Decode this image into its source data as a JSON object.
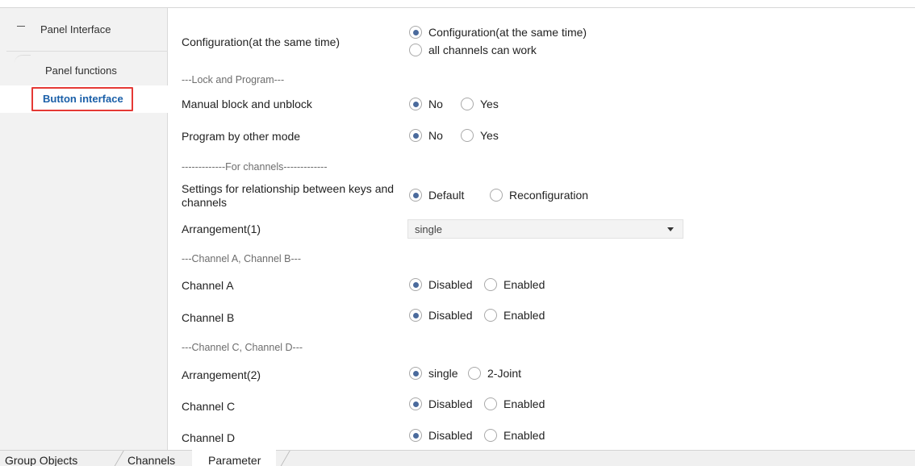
{
  "sidebar": {
    "root_label": "Panel Interface",
    "items": [
      {
        "label": "Panel functions"
      },
      {
        "label": "Button interface"
      }
    ]
  },
  "params": {
    "config": {
      "label": "Configuration(at the same time)",
      "options": [
        "Configuration(at the same time)",
        "all channels can work"
      ],
      "selected": 0
    },
    "heading_lock": "---Lock and Program---",
    "manual_block": {
      "label": "Manual block and unblock",
      "options": [
        "No",
        "Yes"
      ],
      "selected": 0
    },
    "program_other": {
      "label": "Program by other mode",
      "options": [
        "No",
        "Yes"
      ],
      "selected": 0
    },
    "heading_channels": "-------------For channels-------------",
    "relationship": {
      "label": "Settings for relationship between keys and channels",
      "options": [
        "Default",
        "Reconfiguration"
      ],
      "selected": 0
    },
    "arrangement1": {
      "label": "Arrangement(1)",
      "value": "single"
    },
    "heading_ab": "---Channel A, Channel B---",
    "channel_a": {
      "label": "Channel A",
      "options": [
        "Disabled",
        "Enabled"
      ],
      "selected": 0
    },
    "channel_b": {
      "label": "Channel B",
      "options": [
        "Disabled",
        "Enabled"
      ],
      "selected": 0
    },
    "heading_cd": "---Channel C, Channel D---",
    "arrangement2": {
      "label": "Arrangement(2)",
      "options": [
        "single",
        "2-Joint"
      ],
      "selected": 0
    },
    "channel_c": {
      "label": "Channel C",
      "options": [
        "Disabled",
        "Enabled"
      ],
      "selected": 0
    },
    "channel_d": {
      "label": "Channel D",
      "options": [
        "Disabled",
        "Enabled"
      ],
      "selected": 0
    }
  },
  "tabs": [
    {
      "label": "Group Objects"
    },
    {
      "label": "Channels"
    },
    {
      "label": "Parameter"
    }
  ],
  "active_tab": 2,
  "colors": {
    "accent": "#1a5fa8",
    "highlight_box": "#e53935",
    "radio_dot": "#4a6a9c"
  }
}
